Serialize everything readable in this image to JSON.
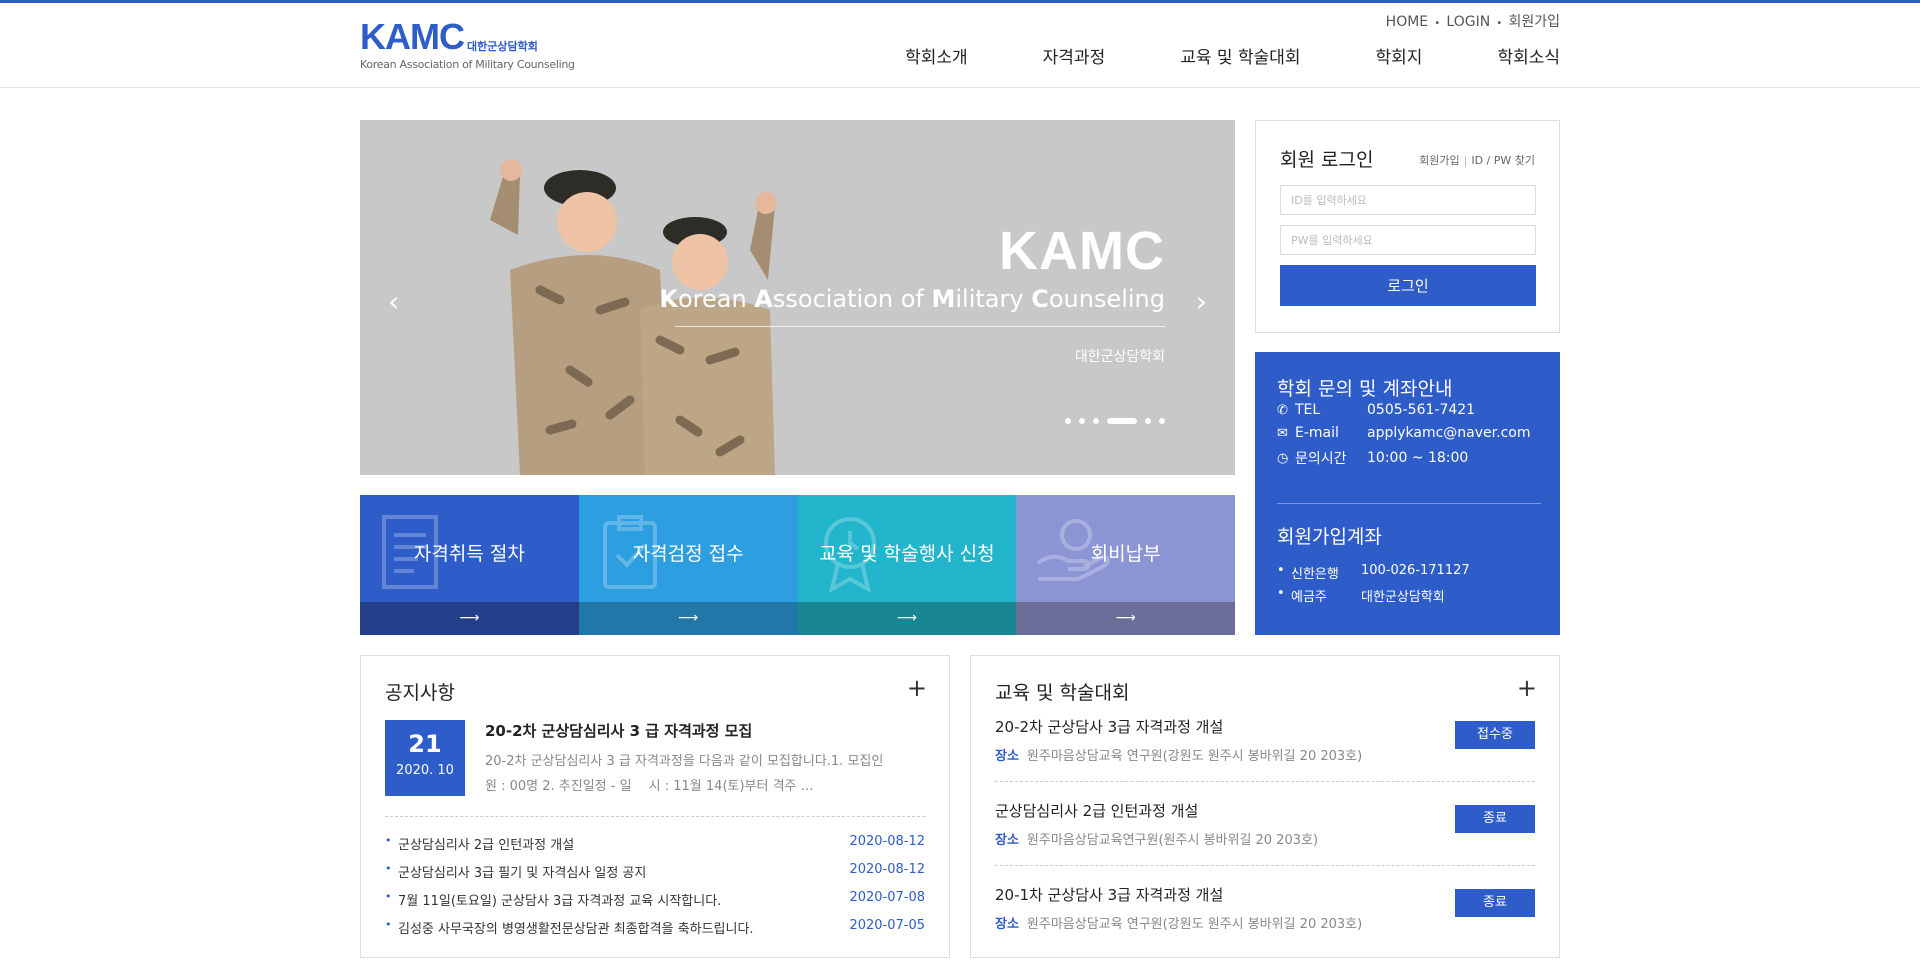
{
  "header": {
    "logo_main": "KAMC",
    "logo_kr": "대한군상담학회",
    "logo_en": "Korean Association of Military Counseling",
    "util": [
      "HOME",
      "LOGIN",
      "회원가입"
    ],
    "nav": [
      "학회소개",
      "자격과정",
      "교육 및 학술대회",
      "학회지",
      "학회소식"
    ]
  },
  "slider": {
    "title": "KAMC",
    "subtitle_parts": [
      {
        "b": "K",
        "t": "orean "
      },
      {
        "b": "A",
        "t": "ssociation of "
      },
      {
        "b": "M",
        "t": "ilitary "
      },
      {
        "b": "C",
        "t": "ounseling"
      }
    ],
    "kr": "대한군상담학회",
    "prev": "‹",
    "next": "›",
    "pager_count": 6,
    "pager_active": 3
  },
  "login": {
    "title": "회원 로그인",
    "join_link": "회원가입",
    "find_link": "ID / PW 찾기",
    "id_placeholder": "ID를 입력하세요",
    "pw_placeholder": "PW를 입력하세요",
    "button": "로그인"
  },
  "info": {
    "title": "학회 문의 및 계좌안내",
    "rows": [
      {
        "icon": "phone-icon",
        "key": "TEL",
        "value": "0505-561-7421"
      },
      {
        "icon": "mail-icon",
        "key": "E-mail",
        "value": "applykamc@naver.com"
      },
      {
        "icon": "clock-icon",
        "key": "문의시간",
        "value": "10:00 ~ 18:00"
      }
    ],
    "acct_title": "회원가입계좌",
    "acct_rows": [
      {
        "key": "신한은행",
        "value": "100-026-171127"
      },
      {
        "key": "예금주",
        "value": "대한군상담학회"
      }
    ]
  },
  "quick": [
    {
      "label": "자격취득 절차",
      "icon": "document-icon",
      "arrow": "⟶"
    },
    {
      "label": "자격검정 접수",
      "icon": "clipboard-icon",
      "arrow": "⟶"
    },
    {
      "label": "교육 및 학술행사 신청",
      "icon": "award-icon",
      "arrow": "⟶"
    },
    {
      "label": "회비납부",
      "icon": "coin-hand-icon",
      "arrow": "⟶"
    }
  ],
  "notice": {
    "title": "공지사항",
    "plus": "+",
    "featured": {
      "day": "21",
      "ym": "2020. 10",
      "title": "20-2차 군상담심리사 3 급 자격과정 모집",
      "desc": "20-2차 군상담심리사 3 급 자격과정을 다음과 같이 모집합니다.1. 모집인원 : 00명 2. 추진일정 - 일　 시 : 11월 14(토)부터 격주 …"
    },
    "items": [
      {
        "text": "군상담심리사 2급 인턴과정 개설",
        "date": "2020-08-12"
      },
      {
        "text": "군상담심리사 3급 필기 및 자격심사 일정 공지",
        "date": "2020-08-12"
      },
      {
        "text": "7월 11일(토요일) 군상담사 3급 자격과정 교육 시작합니다.",
        "date": "2020-07-08"
      },
      {
        "text": "김성중 사무국장의 병영생활전문상담관 최종합격을 축하드립니다.",
        "date": "2020-07-05"
      }
    ]
  },
  "edu": {
    "title": "교육 및 학술대회",
    "plus": "+",
    "place_label": "장소",
    "items": [
      {
        "title": "20-2차 군상담사 3급 자격과정 개설",
        "place": "원주마음상담교육 연구원(강원도 원주시 봉바위길 20 203호)",
        "status": "접수중"
      },
      {
        "title": "군상담심리사 2급 인턴과정 개설",
        "place": "원주마음상담교육연구원(원주시 봉바위길 20 203호)",
        "status": "종료"
      },
      {
        "title": "20-1차 군상담사 3급 자격과정 개설",
        "place": "원주마음상담교육 연구원(강원도 원주시 봉바위길 20 203호)",
        "status": "종료"
      }
    ]
  },
  "colors": {
    "brand": "#2e5cc8",
    "quick1": "#2e5cc8",
    "quick2": "#2d9ee0",
    "quick3": "#22b5cc",
    "quick4": "#8c95d3"
  }
}
